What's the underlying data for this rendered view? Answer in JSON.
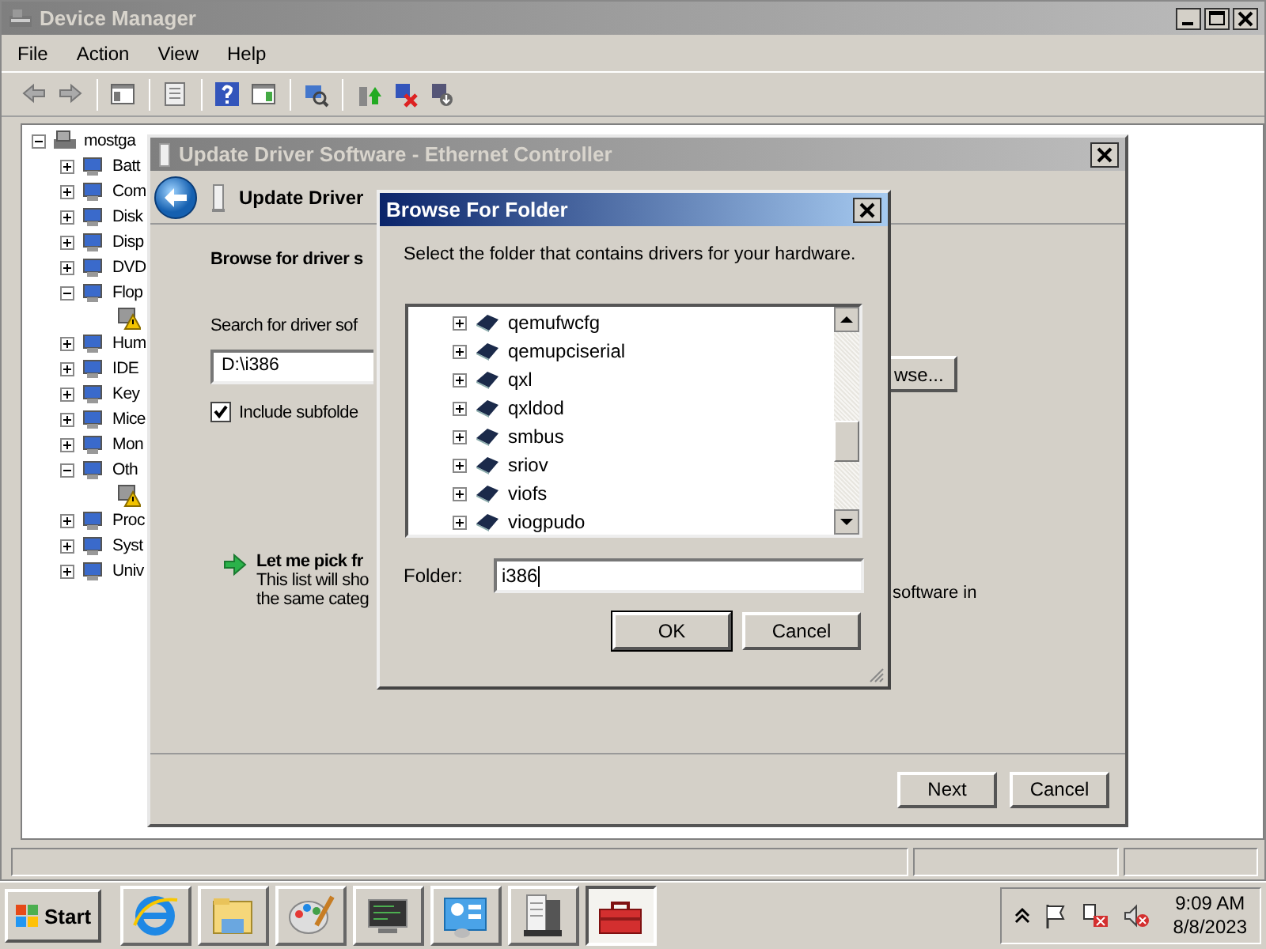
{
  "device_manager": {
    "title": "Device Manager",
    "menu": [
      "File",
      "Action",
      "View",
      "Help"
    ],
    "tree": {
      "label": "mostga",
      "expanded": true,
      "children": [
        {
          "label": "Batt",
          "expanded": false
        },
        {
          "label": "Com",
          "expanded": false
        },
        {
          "label": "Disk",
          "expanded": false
        },
        {
          "label": "Disp",
          "expanded": false
        },
        {
          "label": "DVD",
          "expanded": false
        },
        {
          "label": "Flop",
          "expanded": true,
          "children": [
            {
              "warning": true
            }
          ]
        },
        {
          "label": "Hum",
          "expanded": false
        },
        {
          "label": "IDE",
          "expanded": false
        },
        {
          "label": "Key",
          "expanded": false
        },
        {
          "label": "Mice",
          "expanded": false
        },
        {
          "label": "Mon",
          "expanded": false
        },
        {
          "label": "Oth",
          "expanded": true,
          "children": [
            {
              "warning": true
            }
          ]
        },
        {
          "label": "Proc",
          "expanded": false
        },
        {
          "label": "Syst",
          "expanded": false
        },
        {
          "label": "Univ",
          "expanded": false
        }
      ]
    }
  },
  "update_driver": {
    "title": "Update Driver Software - Ethernet Controller",
    "header": "Update Driver",
    "heading": "Browse for driver s",
    "search_label": "Search for driver sof",
    "path": "D:\\i386",
    "include_subfolders": {
      "label": "Include subfolde",
      "checked": true
    },
    "browse_button": "wse...",
    "pick_title": "Let me pick fr",
    "pick_line_1": "This list will sho",
    "pick_line_2": "the same categ",
    "pick_line_1_end": "software in",
    "buttons": [
      "Next",
      "Cancel"
    ]
  },
  "browse_dialog": {
    "title": "Browse For Folder",
    "prompt": "Select the folder that contains drivers for your hardware.",
    "folders": [
      {
        "label": "qemufwcfg",
        "expanded": false
      },
      {
        "label": "qemupciserial",
        "expanded": false
      },
      {
        "label": "qxl",
        "expanded": false
      },
      {
        "label": "qxldod",
        "expanded": false
      },
      {
        "label": "smbus",
        "expanded": false
      },
      {
        "label": "sriov",
        "expanded": false
      },
      {
        "label": "viofs",
        "expanded": false
      },
      {
        "label": "viogpudo",
        "expanded": false
      }
    ],
    "folder_label": "Folder:",
    "folder_value": "i386",
    "buttons": [
      "OK",
      "Cancel"
    ]
  },
  "taskbar": {
    "start": "Start",
    "apps": [
      {
        "kind": "browser",
        "selected": false
      },
      {
        "kind": "folder",
        "selected": false
      },
      {
        "kind": "paint",
        "selected": false
      },
      {
        "kind": "terminal",
        "selected": false
      },
      {
        "kind": "panel",
        "selected": false
      },
      {
        "kind": "server",
        "selected": false
      },
      {
        "kind": "toolbox",
        "selected": true
      }
    ],
    "time": "9:09 AM",
    "date": "8/8/2023"
  }
}
